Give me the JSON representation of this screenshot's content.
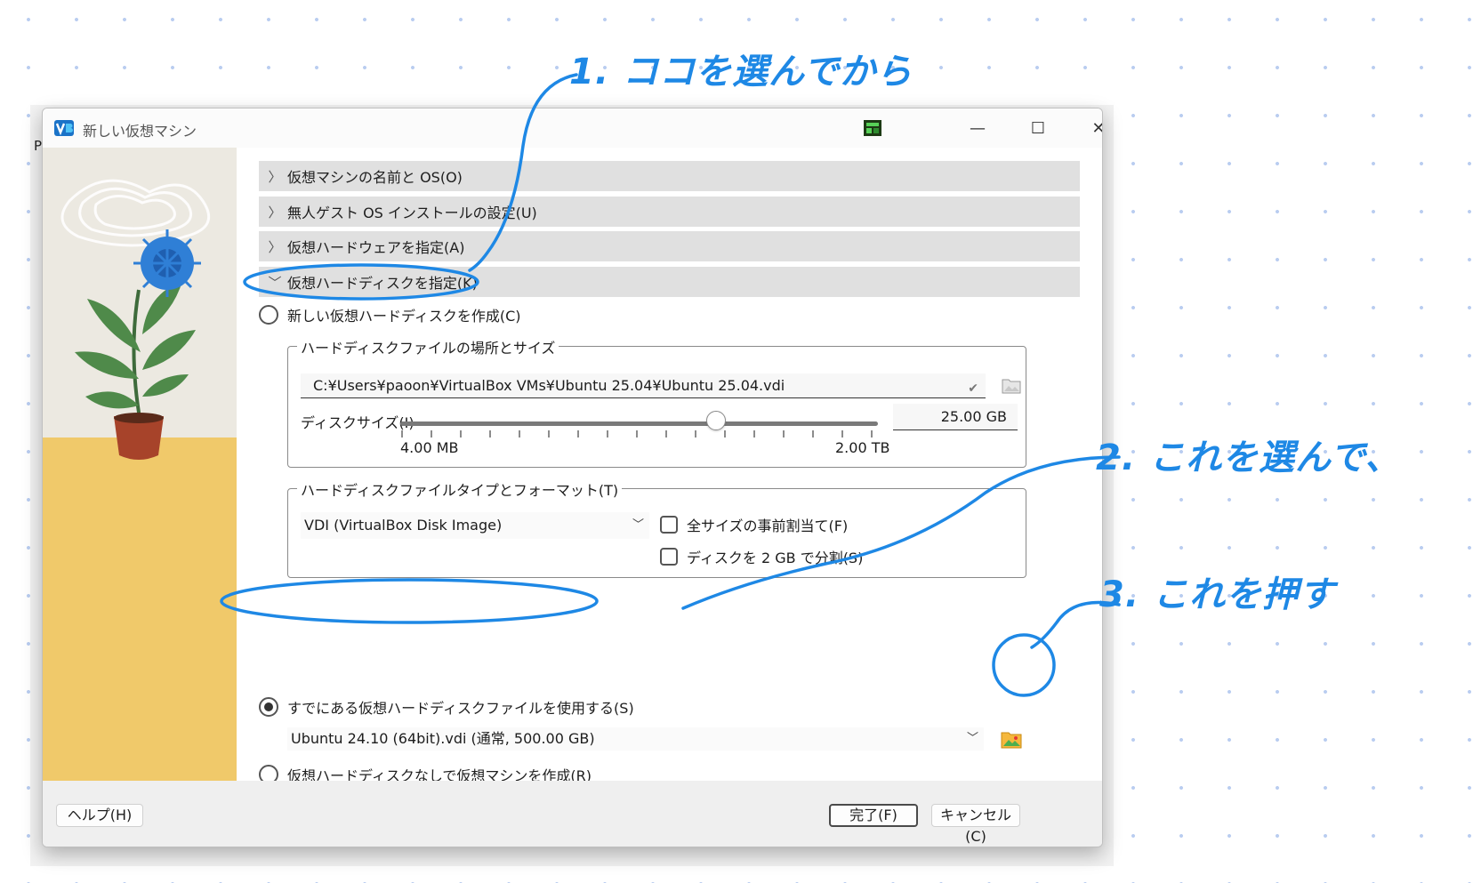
{
  "window": {
    "title": "新しい仮想マシン"
  },
  "background": {
    "tab_label": "P"
  },
  "sections": [
    {
      "label": "仮想マシンの名前と OS(O)",
      "expanded": false
    },
    {
      "label": "無人ゲスト OS インストールの設定(U)",
      "expanded": false
    },
    {
      "label": "仮想ハードウェアを指定(A)",
      "expanded": false
    },
    {
      "label": "仮想ハードディスクを指定(K)",
      "expanded": true
    }
  ],
  "disk": {
    "create_new_label": "新しい仮想ハードディスクを作成(C)",
    "location_group_title": "ハードディスクファイルの場所とサイズ",
    "path_value": "C:¥Users¥paoon¥VirtualBox VMs¥Ubuntu 25.04¥Ubuntu 25.04.vdi",
    "size_label": "ディスクサイズ(I)",
    "size_value": "25.00 GB",
    "size_min": "4.00 MB",
    "size_max": "2.00 TB",
    "format_group_title": "ハードディスクファイルタイプとフォーマット(T)",
    "format_selected": "VDI (VirtualBox Disk Image)",
    "preallocate_label": "全サイズの事前割当て(F)",
    "preallocate_checked": false,
    "split_label": "ディスクを 2 GB で分割(S)",
    "split_checked": false,
    "use_existing_label": "すでにある仮想ハードディスクファイルを使用する(S)",
    "use_existing_selected": true,
    "existing_selected": "Ubuntu 24.10 (64bit).vdi (通常, 500.00 GB)",
    "no_disk_label": "仮想ハードディスクなしで仮想マシンを作成(R)"
  },
  "footer": {
    "help_label": "ヘルプ(H)",
    "finish_label": "完了(F)",
    "cancel_label": "キャンセル(C)"
  },
  "annotations": {
    "note_1": "1. ココを選んでから",
    "note_2": "2. これを選んで、",
    "note_3": "3. これを押す"
  },
  "colors": {
    "annotation": "#1e88e5",
    "section_bg": "#e0e0e0",
    "footer_bg": "#efefef",
    "wall": "#ece9e1",
    "floor": "#f0c96a",
    "flower": "#2f7fd6"
  }
}
